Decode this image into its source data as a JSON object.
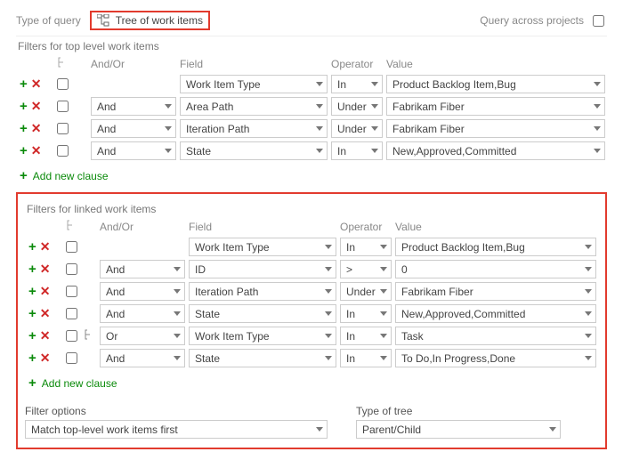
{
  "header": {
    "typeOfQueryLabel": "Type of query",
    "treeLabel": "Tree of work items",
    "acrossProjectsLabel": "Query across projects"
  },
  "columns": {
    "andOr": "And/Or",
    "field": "Field",
    "operator": "Operator",
    "value": "Value"
  },
  "topFilters": {
    "title": "Filters for top level work items",
    "rows": [
      {
        "grouped": false,
        "andOr": "",
        "field": "Work Item Type",
        "operator": "In",
        "value": "Product Backlog Item,Bug"
      },
      {
        "grouped": false,
        "andOr": "And",
        "field": "Area Path",
        "operator": "Under",
        "value": "Fabrikam Fiber"
      },
      {
        "grouped": false,
        "andOr": "And",
        "field": "Iteration Path",
        "operator": "Under",
        "value": "Fabrikam Fiber"
      },
      {
        "grouped": false,
        "andOr": "And",
        "field": "State",
        "operator": "In",
        "value": "New,Approved,Committed"
      }
    ],
    "addLabel": "Add new clause"
  },
  "linkedFilters": {
    "title": "Filters for linked work items",
    "rows": [
      {
        "grouped": false,
        "andOr": "",
        "field": "Work Item Type",
        "operator": "In",
        "value": "Product Backlog Item,Bug"
      },
      {
        "grouped": false,
        "andOr": "And",
        "field": "ID",
        "operator": ">",
        "value": "0"
      },
      {
        "grouped": false,
        "andOr": "And",
        "field": "Iteration Path",
        "operator": "Under",
        "value": "Fabrikam Fiber"
      },
      {
        "grouped": false,
        "andOr": "And",
        "field": "State",
        "operator": "In",
        "value": "New,Approved,Committed"
      },
      {
        "grouped": true,
        "andOr": "Or",
        "field": "Work Item Type",
        "operator": "In",
        "value": "Task"
      },
      {
        "grouped": true,
        "andOr": "And",
        "field": "State",
        "operator": "In",
        "value": "To Do,In Progress,Done"
      }
    ],
    "addLabel": "Add new clause"
  },
  "options": {
    "filterOptionsLabel": "Filter options",
    "filterOptionsValue": "Match top-level work items first",
    "typeOfTreeLabel": "Type of tree",
    "typeOfTreeValue": "Parent/Child"
  }
}
